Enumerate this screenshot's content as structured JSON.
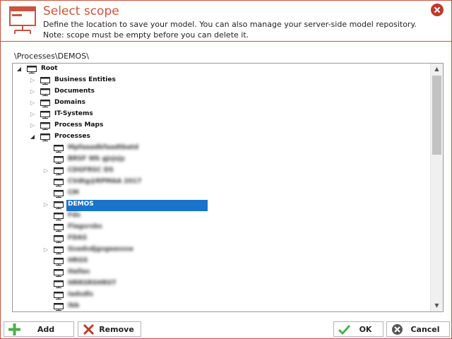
{
  "dialog": {
    "title": "Select scope",
    "description": "Define the location to save your model. You can also manage your server-side model repository. Note: scope must be empty before you can delete it.",
    "path": "\\Processes\\DEMOS\\",
    "colors": {
      "accent": "#c8553d",
      "selection": "#1a73c8",
      "close": "#c0392b",
      "ok": "#4caf50"
    }
  },
  "tree": {
    "root": "Root",
    "items": [
      {
        "label": "Business Entities",
        "expander": "collapsed"
      },
      {
        "label": "Documents",
        "expander": "collapsed"
      },
      {
        "label": "Domains",
        "expander": "collapsed"
      },
      {
        "label": "IT-Systems",
        "expander": "collapsed"
      },
      {
        "label": "Process Maps",
        "expander": "collapsed"
      },
      {
        "label": "Processes",
        "expander": "expanded"
      }
    ],
    "processes_children": [
      {
        "label": "Mpfaaadkfaadtbatd",
        "obscured": true,
        "expander": "none"
      },
      {
        "label": "BRSF Wk gjsjsjy",
        "obscured": true,
        "expander": "none"
      },
      {
        "label": "CDGFRSC DS",
        "obscured": true,
        "expander": "collapsed"
      },
      {
        "label": "CVdtg@RPMAA 2017",
        "obscured": true,
        "expander": "none"
      },
      {
        "label": "CM",
        "obscured": true,
        "expander": "none"
      },
      {
        "label": "DEMOS",
        "obscured": false,
        "expander": "collapsed",
        "selected": true
      },
      {
        "label": "Fds",
        "obscured": true,
        "expander": "none"
      },
      {
        "label": "Flagsrsbs",
        "obscured": true,
        "expander": "none"
      },
      {
        "label": "FDAS",
        "obscured": true,
        "expander": "none"
      },
      {
        "label": "Gsadsdjgsgaasssa",
        "obscured": true,
        "expander": "collapsed"
      },
      {
        "label": "HRGS",
        "obscured": true,
        "expander": "none"
      },
      {
        "label": "Hallas",
        "obscured": true,
        "expander": "none"
      },
      {
        "label": "HRRSRSHRST",
        "obscured": true,
        "expander": "none"
      },
      {
        "label": "Iadsdls",
        "obscured": true,
        "expander": "none"
      },
      {
        "label": "Ibb",
        "obscured": true,
        "expander": "none"
      }
    ]
  },
  "buttons": {
    "add": "Add",
    "remove": "Remove",
    "ok": "OK",
    "cancel": "Cancel"
  }
}
